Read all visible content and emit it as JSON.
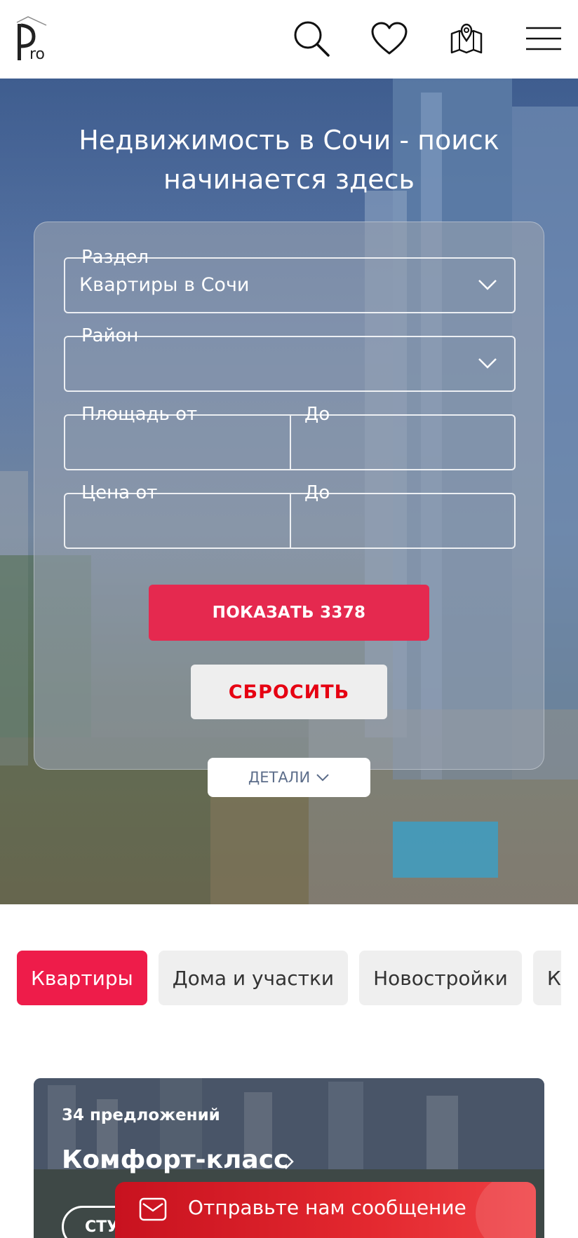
{
  "header": {
    "logo_text": "Pro",
    "icons": [
      "search-icon",
      "heart-icon",
      "map-icon",
      "menu-icon"
    ]
  },
  "hero": {
    "title_line1": "Недвижимость в Сочи - поиск",
    "title_line2": "начинается здесь"
  },
  "search": {
    "section": {
      "label": "Раздел",
      "value": "Квартиры в Сочи"
    },
    "district": {
      "label": "Район",
      "value": ""
    },
    "area_from": {
      "label": "Площадь от",
      "value": ""
    },
    "area_to": {
      "label": "До",
      "value": ""
    },
    "price_from": {
      "label": "Цена от",
      "value": ""
    },
    "price_to": {
      "label": "До",
      "value": ""
    },
    "show_button": "ПОКАЗАТЬ 3378",
    "reset_button": "СБРОСИТЬ",
    "details_button": "ДЕТАЛИ"
  },
  "tabs": [
    {
      "label": "Квартиры",
      "active": true
    },
    {
      "label": "Дома и участки",
      "active": false
    },
    {
      "label": "Новостройки",
      "active": false
    },
    {
      "label": "Ком",
      "active": false
    }
  ],
  "card": {
    "count": "34 предложений",
    "title": "Комфорт-класс",
    "chip": "СТУ"
  },
  "chat": {
    "label": "Отправьте нам сообщение"
  },
  "colors": {
    "accent": "#ee1c4a",
    "reset_text": "#e60012",
    "chat": "#e3282f"
  }
}
